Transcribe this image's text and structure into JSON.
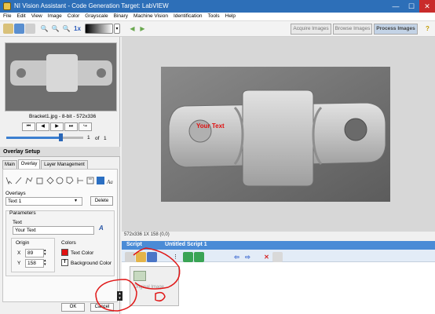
{
  "window": {
    "title": "NI Vision Assistant - Code Generation Target: LabVIEW",
    "minimize": "—",
    "maximize": "☐",
    "close": "✕"
  },
  "menu": [
    "File",
    "Edit",
    "View",
    "Image",
    "Color",
    "Grayscale",
    "Binary",
    "Machine Vision",
    "Identification",
    "Tools",
    "Help"
  ],
  "toolbar": {
    "tabs": [
      "Acquire Images",
      "Browse Images",
      "Process Images"
    ],
    "help_icon": "?"
  },
  "browser": {
    "filename": "Bracket1.jpg - 8-bit - 572x336",
    "nav_buttons": [
      "⏮",
      "◀",
      "▶",
      "⏭",
      "↪"
    ],
    "page_current": "1",
    "page_of": "of",
    "page_total": "1",
    "slider_fraction": 0.7
  },
  "overlay_setup": {
    "title": "Overlay Setup",
    "tabs": [
      "Main",
      "Overlay",
      "Layer Management"
    ],
    "overlays_label": "Overlays",
    "overlays_selected": "Text 1",
    "delete_label": "Delete",
    "parameters_label": "Parameters",
    "text_label": "Text",
    "text_value": "Your Text",
    "origin_label": "Origin",
    "x_label": "X",
    "x_value": "89",
    "y_label": "Y",
    "y_value": "158",
    "colors_label": "Colors",
    "text_color_label": "Text Color",
    "bg_color_label": "Background Color",
    "text_color": "#e01010",
    "ok_label": "OK",
    "cancel_label": "Cancel"
  },
  "image_view": {
    "overlay_text": "Your Text",
    "overlay_color": "#e01010",
    "status": "572x336 1X 158    (0,0)"
  },
  "script": {
    "title_left": "Script",
    "title_main": "Untitled Script 1",
    "step_label": "Original Image"
  }
}
